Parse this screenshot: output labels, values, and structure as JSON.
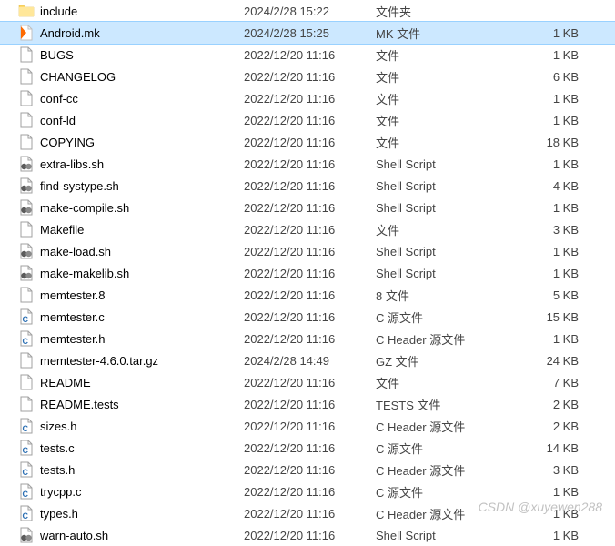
{
  "watermark": "CSDN @xuyewen288",
  "files": [
    {
      "name": "include",
      "date": "2024/2/28 15:22",
      "type": "文件夹",
      "size": "",
      "icon": "folder",
      "selected": false
    },
    {
      "name": "Android.mk",
      "date": "2024/2/28 15:25",
      "type": "MK 文件",
      "size": "1 KB",
      "icon": "mk",
      "selected": true
    },
    {
      "name": "BUGS",
      "date": "2022/12/20 11:16",
      "type": "文件",
      "size": "1 KB",
      "icon": "file",
      "selected": false
    },
    {
      "name": "CHANGELOG",
      "date": "2022/12/20 11:16",
      "type": "文件",
      "size": "6 KB",
      "icon": "file",
      "selected": false
    },
    {
      "name": "conf-cc",
      "date": "2022/12/20 11:16",
      "type": "文件",
      "size": "1 KB",
      "icon": "file",
      "selected": false
    },
    {
      "name": "conf-ld",
      "date": "2022/12/20 11:16",
      "type": "文件",
      "size": "1 KB",
      "icon": "file",
      "selected": false
    },
    {
      "name": "COPYING",
      "date": "2022/12/20 11:16",
      "type": "文件",
      "size": "18 KB",
      "icon": "file",
      "selected": false
    },
    {
      "name": "extra-libs.sh",
      "date": "2022/12/20 11:16",
      "type": "Shell Script",
      "size": "1 KB",
      "icon": "sh",
      "selected": false
    },
    {
      "name": "find-systype.sh",
      "date": "2022/12/20 11:16",
      "type": "Shell Script",
      "size": "4 KB",
      "icon": "sh",
      "selected": false
    },
    {
      "name": "make-compile.sh",
      "date": "2022/12/20 11:16",
      "type": "Shell Script",
      "size": "1 KB",
      "icon": "sh",
      "selected": false
    },
    {
      "name": "Makefile",
      "date": "2022/12/20 11:16",
      "type": "文件",
      "size": "3 KB",
      "icon": "file",
      "selected": false
    },
    {
      "name": "make-load.sh",
      "date": "2022/12/20 11:16",
      "type": "Shell Script",
      "size": "1 KB",
      "icon": "sh",
      "selected": false
    },
    {
      "name": "make-makelib.sh",
      "date": "2022/12/20 11:16",
      "type": "Shell Script",
      "size": "1 KB",
      "icon": "sh",
      "selected": false
    },
    {
      "name": "memtester.8",
      "date": "2022/12/20 11:16",
      "type": "8 文件",
      "size": "5 KB",
      "icon": "file",
      "selected": false
    },
    {
      "name": "memtester.c",
      "date": "2022/12/20 11:16",
      "type": "C 源文件",
      "size": "15 KB",
      "icon": "c",
      "selected": false
    },
    {
      "name": "memtester.h",
      "date": "2022/12/20 11:16",
      "type": "C Header 源文件",
      "size": "1 KB",
      "icon": "c",
      "selected": false
    },
    {
      "name": "memtester-4.6.0.tar.gz",
      "date": "2024/2/28 14:49",
      "type": "GZ 文件",
      "size": "24 KB",
      "icon": "file",
      "selected": false
    },
    {
      "name": "README",
      "date": "2022/12/20 11:16",
      "type": "文件",
      "size": "7 KB",
      "icon": "file",
      "selected": false
    },
    {
      "name": "README.tests",
      "date": "2022/12/20 11:16",
      "type": "TESTS 文件",
      "size": "2 KB",
      "icon": "file",
      "selected": false
    },
    {
      "name": "sizes.h",
      "date": "2022/12/20 11:16",
      "type": "C Header 源文件",
      "size": "2 KB",
      "icon": "c",
      "selected": false
    },
    {
      "name": "tests.c",
      "date": "2022/12/20 11:16",
      "type": "C 源文件",
      "size": "14 KB",
      "icon": "c",
      "selected": false
    },
    {
      "name": "tests.h",
      "date": "2022/12/20 11:16",
      "type": "C Header 源文件",
      "size": "3 KB",
      "icon": "c",
      "selected": false
    },
    {
      "name": "trycpp.c",
      "date": "2022/12/20 11:16",
      "type": "C 源文件",
      "size": "1 KB",
      "icon": "c",
      "selected": false
    },
    {
      "name": "types.h",
      "date": "2022/12/20 11:16",
      "type": "C Header 源文件",
      "size": "1 KB",
      "icon": "c",
      "selected": false
    },
    {
      "name": "warn-auto.sh",
      "date": "2022/12/20 11:16",
      "type": "Shell Script",
      "size": "1 KB",
      "icon": "sh",
      "selected": false
    }
  ]
}
